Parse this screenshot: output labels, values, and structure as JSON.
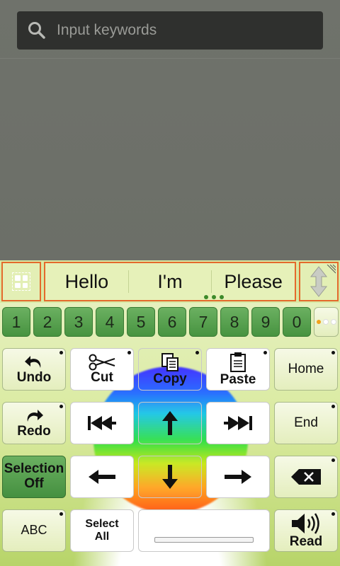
{
  "search": {
    "placeholder": "Input keywords"
  },
  "suggestions": [
    "Hello",
    "I'm",
    "Please"
  ],
  "numbers": [
    "1",
    "2",
    "3",
    "4",
    "5",
    "6",
    "7",
    "8",
    "9",
    "0"
  ],
  "keys": {
    "undo": "Undo",
    "redo": "Redo",
    "cut": "Cut",
    "copy": "Copy",
    "paste": "Paste",
    "home": "Home",
    "end": "End",
    "selection_off_line1": "Selection",
    "selection_off_line2": "Off",
    "abc": "ABC",
    "select_all_line1": "Select",
    "select_all_line2": "All",
    "read": "Read"
  },
  "colors": {
    "accent_border": "#e46a2c",
    "number_key": "#4f9a47",
    "keyboard_bg": "#d9ea9e"
  }
}
